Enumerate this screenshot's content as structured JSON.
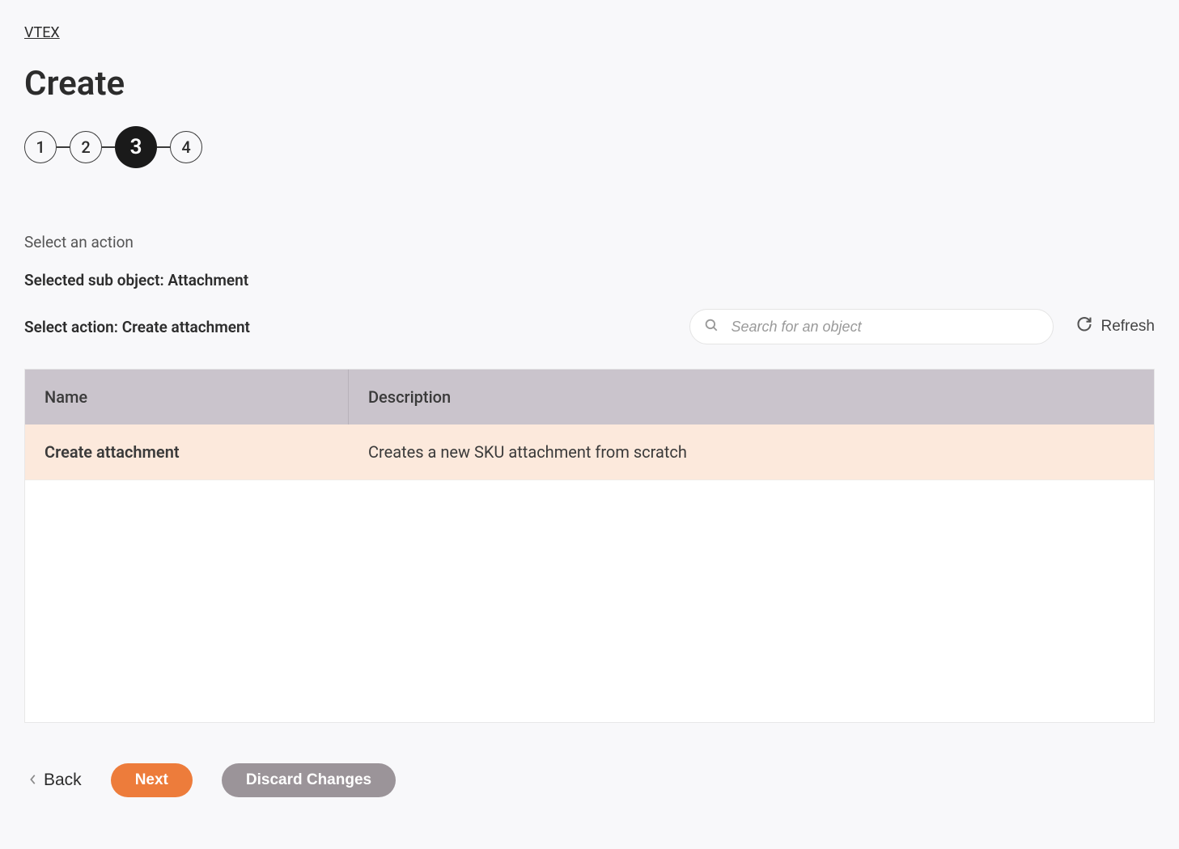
{
  "breadcrumb": {
    "label": "VTEX"
  },
  "page": {
    "title": "Create"
  },
  "stepper": {
    "steps": [
      "1",
      "2",
      "3",
      "4"
    ],
    "active_index": 2
  },
  "section": {
    "label": "Select an action",
    "selected_sub_object": "Selected sub object: Attachment",
    "selected_action": "Select action: Create attachment"
  },
  "search": {
    "placeholder": "Search for an object"
  },
  "refresh": {
    "label": "Refresh"
  },
  "table": {
    "headers": {
      "name": "Name",
      "description": "Description"
    },
    "rows": [
      {
        "name": "Create attachment",
        "description": "Creates a new SKU attachment from scratch"
      }
    ]
  },
  "footer": {
    "back": "Back",
    "next": "Next",
    "discard": "Discard Changes"
  }
}
